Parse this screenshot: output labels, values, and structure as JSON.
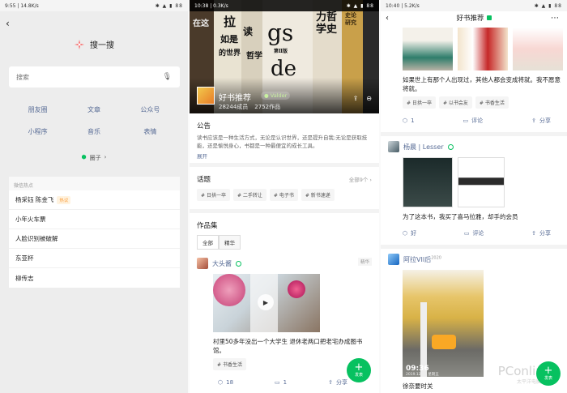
{
  "panel1": {
    "status_time": "9:55",
    "status_speed": "14.8K/s",
    "status_battery": "88",
    "title": "搜一搜",
    "search_placeholder": "搜索",
    "categories": [
      "朋友圈",
      "文章",
      "公众号",
      "小程序",
      "音乐",
      "表情"
    ],
    "circle_label": "圈子",
    "hot_title": "微信热点",
    "hot_items": [
      {
        "text": "杨采钰 陈金飞",
        "badge": "热议"
      },
      {
        "text": "小年火车票",
        "badge": ""
      },
      {
        "text": "人脸识别被破解",
        "badge": ""
      },
      {
        "text": "东亚杯",
        "badge": ""
      },
      {
        "text": "柳传志",
        "badge": ""
      }
    ]
  },
  "panel2": {
    "status_time": "10:38",
    "status_speed": "0.3K/s",
    "status_battery": "88",
    "hero_words": [
      "在这",
      "拉",
      "如是",
      "读",
      "gs",
      "de",
      "哲学",
      "力哲学史",
      "史论研究",
      "第Ⅱ版",
      "的世界"
    ],
    "group_name": "好书推荐",
    "owner": "Valder",
    "members": "28244成员",
    "works": "2752作品",
    "notice_title": "公告",
    "notice_text": "读书应该是一种生活方式，无论是认识世界，还是提升自我;无论是获取技能，还是愉悦身心，书都是一种最便宜的成长工具。",
    "expand": "展开",
    "topics_title": "话题",
    "topics_all": "全部9个 ›",
    "topics": [
      "日拱一卒",
      "二手转让",
      "电子书",
      "新书速递"
    ],
    "works_title": "作品集",
    "filters": [
      "全部",
      "精华"
    ],
    "post": {
      "author": "大头酱",
      "essence": "精华",
      "text": "村里50多年没出一个大学生 退休老两口把老宅办成图书馆。",
      "tag": "书香生活",
      "likes": "18",
      "comments": "1",
      "share": "分享"
    },
    "fab_label": "发表"
  },
  "panel3": {
    "status_time": "10:40",
    "status_speed": "5.2K/s",
    "status_battery": "88",
    "header_title": "好书推荐",
    "post1": {
      "text": "如果世上有那个人出现过，其他人都会变成将就。我不愿意将就。",
      "tags": [
        "日拱一卒",
        "以书会友",
        "书香生活"
      ],
      "likes": "1",
      "comment": "评论",
      "share": "分享"
    },
    "post2": {
      "author": "杨晨 | Lesser",
      "text": "为了这本书，我买了喜马拉雅，却手的会员",
      "like": "好",
      "comment": "评论",
      "share": "分享"
    },
    "post3": {
      "author": "阿拉VII后",
      "sup": "2020",
      "time": "09:36",
      "date": "2019.12.13 星期五",
      "text": "徐奈要时关"
    },
    "watermark": "PConline",
    "watermark_sub": "太平洋电脑网"
  }
}
